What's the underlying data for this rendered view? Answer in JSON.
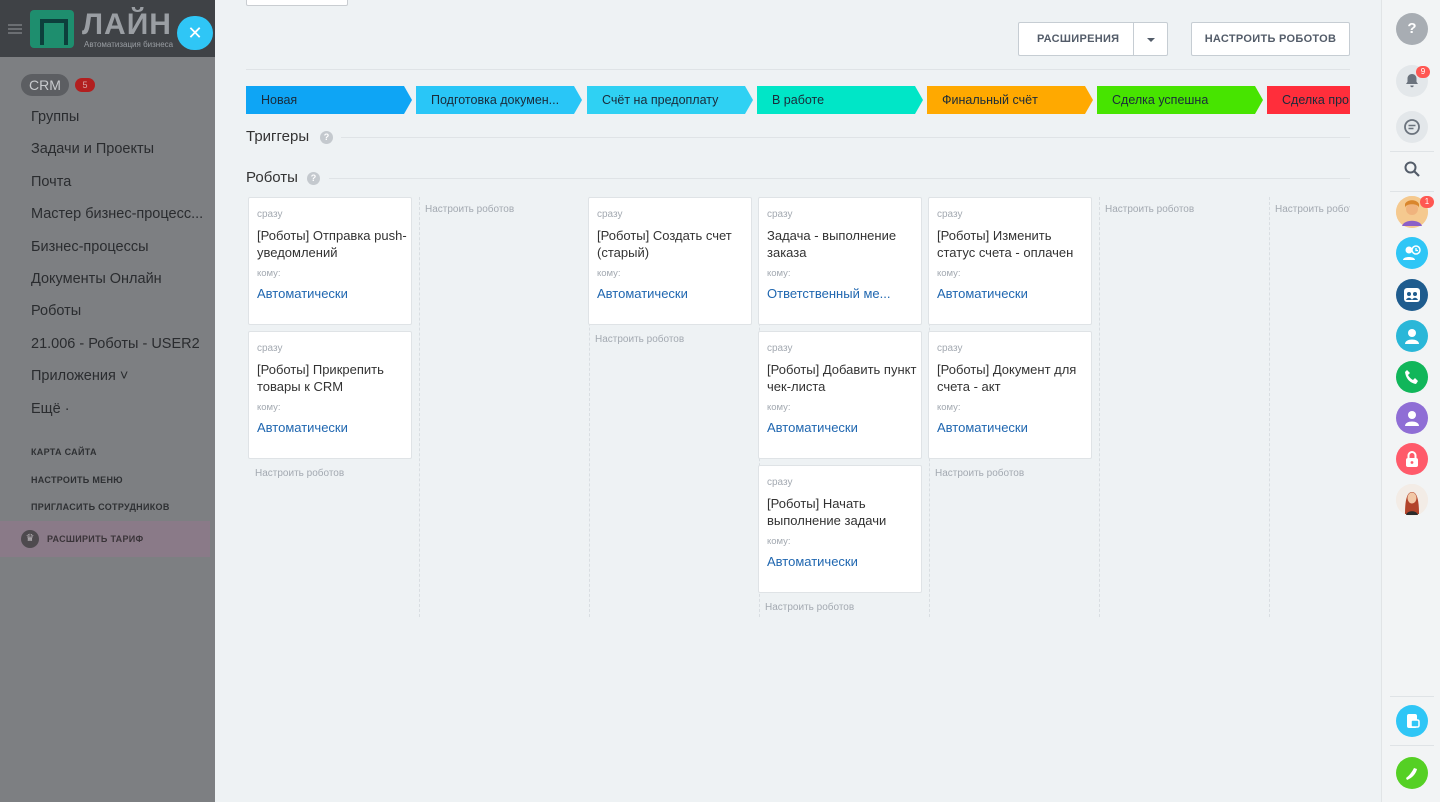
{
  "sidebar": {
    "logo_title": "ЛАЙН",
    "logo_subtitle": "Автоматизация бизнеса",
    "close_glyph": "✕",
    "crm_label": "CRM",
    "crm_badge": "5",
    "items": [
      "Группы",
      "Задачи и Проекты",
      "Почта",
      "Мастер бизнес-процесс...",
      "Бизнес-процессы",
      "Документы Онлайн",
      "Роботы",
      "21.006 - Роботы - USER2",
      "Приложения ˅",
      "Ещё ·"
    ],
    "site_map": "КАРТА САЙТА",
    "configure_menu": "НАСТРОИТЬ МЕНЮ",
    "invite": "ПРИГЛАСИТЬ СОТРУДНИКОВ",
    "upgrade": "РАСШИРИТЬ ТАРИФ",
    "crown_glyph": "♛"
  },
  "toolbar": {
    "extensions_label": "РАСШИРЕНИЯ",
    "configure_robots_label": "НАСТРОИТЬ РОБОТОВ"
  },
  "stages": [
    {
      "label": "Новая",
      "color": "#0ea5f5"
    },
    {
      "label": "Подготовка докумен...",
      "color": "#29c6f7"
    },
    {
      "label": "Счёт на предоплату",
      "color": "#2fd1f3"
    },
    {
      "label": "В работе",
      "color": "#00e6c7"
    },
    {
      "label": "Финальный счёт",
      "color": "#ffa900"
    },
    {
      "label": "Сделка успешна",
      "color": "#47e400"
    },
    {
      "label": "Сделка про",
      "color": "#ff2e3b"
    }
  ],
  "sections": {
    "triggers": "Триггеры",
    "robots": "Роботы",
    "help_glyph": "?"
  },
  "setup_link": "Настроить роботов",
  "robot_columns": [
    {
      "cards": [
        {
          "when": "сразу",
          "title": "[Роботы] Отправка push-уведомлений",
          "to": "кому:",
          "responsible": "Автоматически"
        },
        {
          "when": "сразу",
          "title": "[Роботы] Прикрепить товары к CRM",
          "to": "кому:",
          "responsible": "Автоматически"
        }
      ]
    },
    {
      "cards": []
    },
    {
      "cards": [
        {
          "when": "сразу",
          "title": "[Роботы] Создать счет (старый)",
          "to": "кому:",
          "responsible": "Автоматически"
        }
      ]
    },
    {
      "cards": [
        {
          "when": "сразу",
          "title": "Задача - выполнение заказа",
          "to": "кому:",
          "responsible": "Ответственный ме..."
        },
        {
          "when": "сразу",
          "title": "[Роботы] Добавить пункт чек-листа",
          "to": "кому:",
          "responsible": "Автоматически"
        },
        {
          "when": "сразу",
          "title": "[Роботы] Начать выполнение задачи",
          "to": "кому:",
          "responsible": "Автоматически"
        }
      ]
    },
    {
      "cards": [
        {
          "when": "сразу",
          "title": "[Роботы] Изменить статус счета - оплачен",
          "to": "кому:",
          "responsible": "Автоматически"
        },
        {
          "when": "сразу",
          "title": "[Роботы] Документ для счета - акт",
          "to": "кому:",
          "responsible": "Автоматически"
        }
      ]
    },
    {
      "cards": []
    },
    {
      "cards": []
    }
  ],
  "rightbar": {
    "help_glyph": "?",
    "notifications_badge": "9",
    "chat_badge": "1",
    "colors": {
      "blue": "#2fc6f6",
      "navy": "#1f5c8e",
      "cyan": "#2ab7d8",
      "green": "#11b65a",
      "purple": "#8f6ed5",
      "pink": "#ff5a6a",
      "call": "#55d024"
    }
  }
}
